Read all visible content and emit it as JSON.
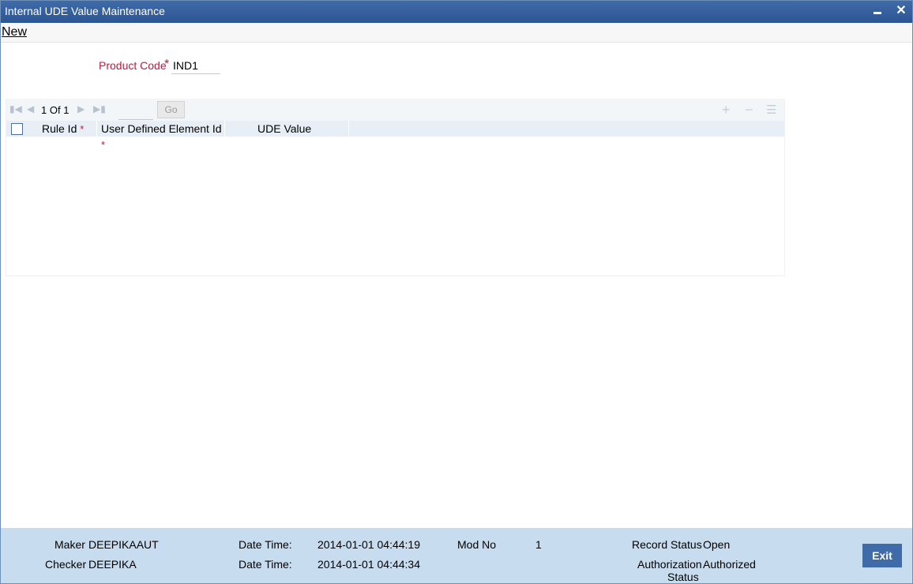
{
  "window": {
    "title": "Internal UDE Value Maintenance",
    "minimize_icon": "minimize-icon",
    "close_label": "✕"
  },
  "menu": {
    "new_label": "New"
  },
  "form": {
    "product_code_label": "Product Code",
    "required_marker": "*",
    "product_code_value": "IND1"
  },
  "grid": {
    "page_current": "1",
    "page_of": "Of",
    "page_total": "1",
    "go_label": "Go",
    "columns": [
      {
        "label": "Rule Id",
        "required": "*"
      },
      {
        "label": "User Defined Element Id",
        "required": "*"
      },
      {
        "label": "UDE Value",
        "required": ""
      }
    ],
    "rows": []
  },
  "footer": {
    "maker_label": "Maker",
    "maker_value": "DEEPIKAAUT",
    "checker_label": "Checker",
    "checker_value": "DEEPIKA",
    "date_time_label": "Date Time:",
    "maker_date_time": "2014-01-01 04:44:19",
    "checker_date_time": "2014-01-01 04:44:34",
    "mod_no_label": "Mod No",
    "mod_no_value": "1",
    "record_status_label": "Record Status",
    "record_status_value": "Open",
    "auth_status_label_1": "Authorization",
    "auth_status_label_2": "Status",
    "auth_status_value": "Authorized",
    "exit_label": "Exit"
  },
  "colors": {
    "title_bar": "#2c5593",
    "required": "#c2183a",
    "footer_bg": "#c8dcef",
    "exit_button": "#3f6ba8"
  }
}
